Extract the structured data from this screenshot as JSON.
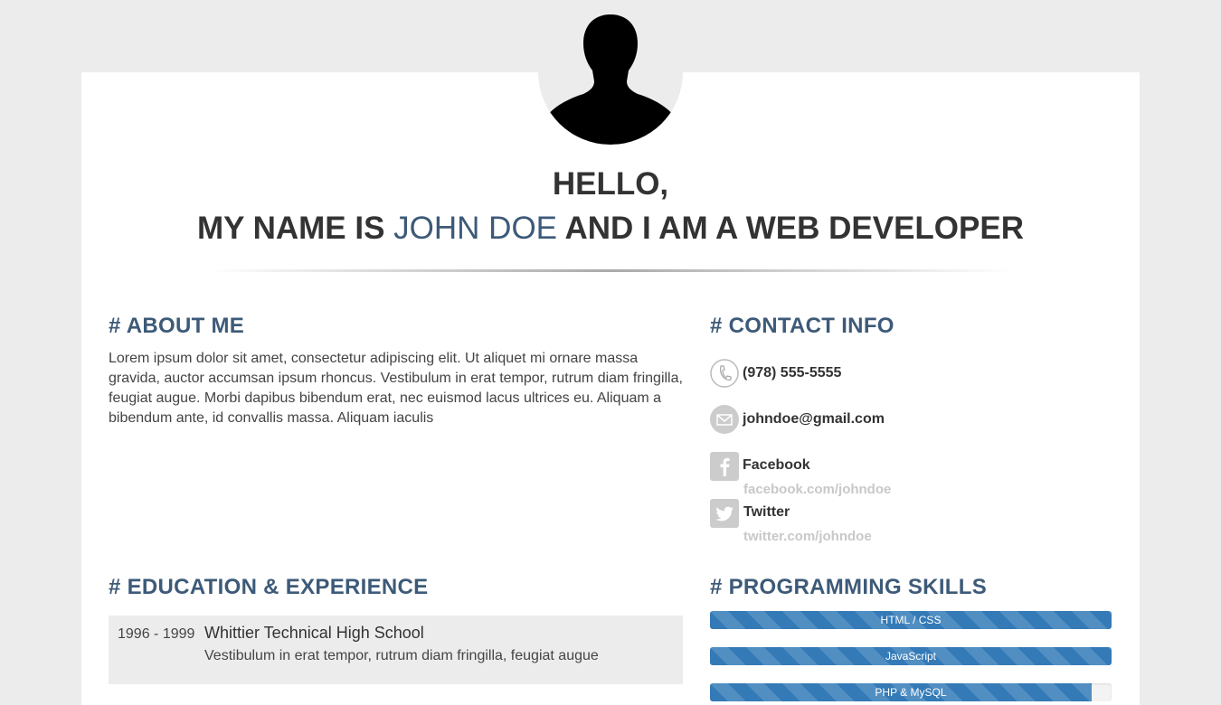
{
  "header": {
    "greeting": "HELLO,",
    "intro_prefix": "MY NAME IS",
    "name": "JOHN DOE",
    "intro_suffix": "AND I AM A WEB DEVELOPER"
  },
  "about": {
    "title": "# ABOUT ME",
    "text": "Lorem ipsum dolor sit amet, consectetur adipiscing elit. Ut aliquet mi ornare massa gravida, auctor accumsan ipsum rhoncus. Vestibulum in erat tempor, rutrum diam fringilla, feugiat augue. Morbi dapibus bibendum erat, nec euismod lacus ultrices eu. Aliquam a bibendum ante, id convallis massa. Aliquam iaculis"
  },
  "contact": {
    "title": "# CONTACT INFO",
    "phone": "(978) 555-5555",
    "email": "johndoe@gmail.com",
    "facebook_label": "Facebook",
    "facebook_url": "facebook.com/johndoe",
    "twitter_label": "Twitter",
    "twitter_url": "twitter.com/johndoe",
    "icons": [
      "phone-icon",
      "mail-icon",
      "facebook-icon",
      "twitter-icon"
    ]
  },
  "education": {
    "title": "# EDUCATION & EXPERIENCE",
    "items": [
      {
        "years": "1996 - 1999",
        "school": "Whittier Technical High School",
        "description": "Vestibulum in erat tempor, rutrum diam fringilla, feugiat augue"
      }
    ]
  },
  "skills": {
    "title": "# PROGRAMMING SKILLS",
    "items": [
      {
        "label": "HTML / CSS",
        "level": 100
      },
      {
        "label": "JavaScript",
        "level": 100
      },
      {
        "label": "PHP & MySQL",
        "level": 95
      }
    ]
  },
  "colors": {
    "accent": "#3d5a78",
    "progress": "#337ab7",
    "background": "#ececec"
  }
}
